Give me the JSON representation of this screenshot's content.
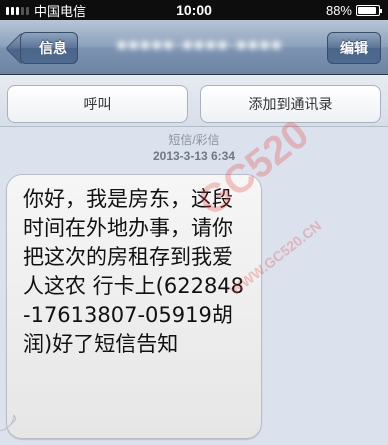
{
  "status_bar": {
    "carrier": "中国电信",
    "time": "10:00",
    "battery": "88%",
    "battery_level": 0.88
  },
  "nav": {
    "back_label": "信息",
    "edit_label": "编辑",
    "title_blurred": "■■■■■-■■■■-■■■■"
  },
  "actions": {
    "call_label": "呼叫",
    "add_contact_label": "添加到通讯录"
  },
  "conversation": {
    "type_label": "短信/彩信",
    "timestamp": "2013-3-13 6:34",
    "message": "你好，我是房东，这段时间在外地办事，请你把这次的房租存到我爱人这农 行卡上(622848-17613807-05919胡润)好了短信告知"
  },
  "watermark": {
    "logo": "GC520",
    "url": "WWW.GC520.CN"
  },
  "colors": {
    "nav_blue": "#6d84a4",
    "bubble_gray": "#ececec",
    "background": "#dbe2ed",
    "watermark_red": "#e63c3c"
  }
}
